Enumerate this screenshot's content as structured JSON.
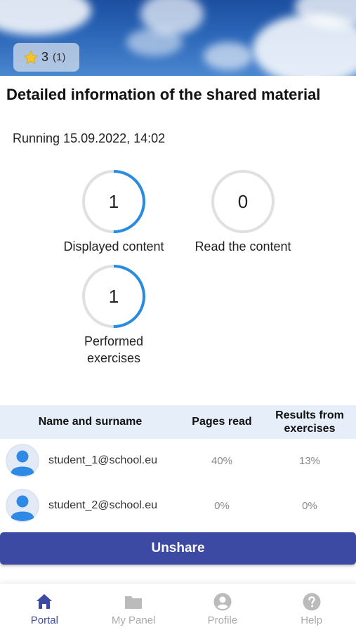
{
  "header": {
    "rating": "3",
    "rating_count": "(1)"
  },
  "title": "Detailed information of the shared material",
  "status": "Running 15.09.2022, 14:02",
  "stats": [
    {
      "value": "1",
      "label": "Displayed content",
      "progress": 0.5
    },
    {
      "value": "0",
      "label": "Read the content",
      "progress": 0
    },
    {
      "value": "1",
      "label": "Performed exercises",
      "progress": 0.5
    }
  ],
  "stats_label_3_line1": "Performed",
  "stats_label_3_line2": "exercises",
  "table": {
    "headers": {
      "name": "Name and surname",
      "pages": "Pages read",
      "results_line1": "Results from",
      "results_line2": "exercises"
    },
    "rows": [
      {
        "email": "student_1@school.eu",
        "pages": "40%",
        "results": "13%"
      },
      {
        "email": "student_2@school.eu",
        "pages": "0%",
        "results": "0%"
      }
    ]
  },
  "actions": {
    "unshare": "Unshare"
  },
  "nav": {
    "items": [
      {
        "label": "Portal",
        "icon": "home-icon",
        "active": true
      },
      {
        "label": "My Panel",
        "icon": "folder-icon",
        "active": false
      },
      {
        "label": "Profile",
        "icon": "profile-icon",
        "active": false
      },
      {
        "label": "Help",
        "icon": "help-icon",
        "active": false
      }
    ]
  },
  "colors": {
    "accent": "#3d4aa3",
    "ring_progress": "#2a8ce0",
    "ring_track": "#e0e0e0",
    "table_header_bg": "#e6eef9"
  }
}
